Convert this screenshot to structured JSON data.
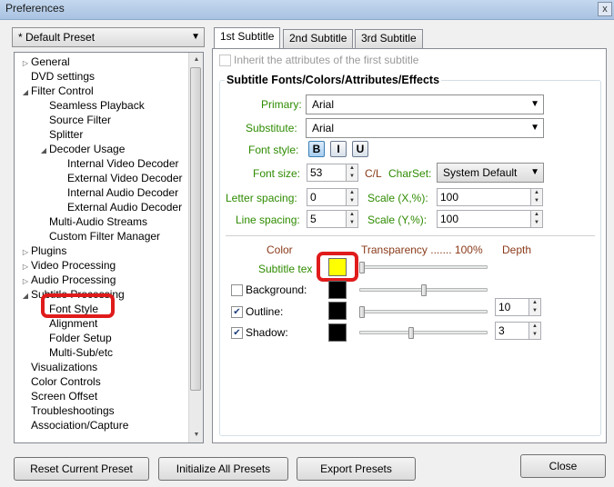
{
  "window": {
    "title": "Preferences",
    "close_glyph": "x"
  },
  "preset_combo": {
    "value": "* Default Preset"
  },
  "tree": [
    {
      "label": "General",
      "expander": "▷",
      "level": 0
    },
    {
      "label": "DVD settings",
      "expander": "",
      "level": 0
    },
    {
      "label": "Filter Control",
      "expander": "◢",
      "level": 0
    },
    {
      "label": "Seamless Playback",
      "expander": "",
      "level": 1
    },
    {
      "label": "Source Filter",
      "expander": "",
      "level": 1
    },
    {
      "label": "Splitter",
      "expander": "",
      "level": 1
    },
    {
      "label": "Decoder Usage",
      "expander": "◢",
      "level": 1
    },
    {
      "label": "Internal Video Decoder",
      "expander": "",
      "level": 2
    },
    {
      "label": "External Video Decoder",
      "expander": "",
      "level": 2
    },
    {
      "label": "Internal Audio Decoder",
      "expander": "",
      "level": 2
    },
    {
      "label": "External Audio Decoder",
      "expander": "",
      "level": 2
    },
    {
      "label": "Multi-Audio Streams",
      "expander": "",
      "level": 1
    },
    {
      "label": "Custom Filter Manager",
      "expander": "",
      "level": 1
    },
    {
      "label": "Plugins",
      "expander": "▷",
      "level": 0
    },
    {
      "label": "Video Processing",
      "expander": "▷",
      "level": 0
    },
    {
      "label": "Audio Processing",
      "expander": "▷",
      "level": 0
    },
    {
      "label": "Subtitle Processing",
      "expander": "◢",
      "level": 0
    },
    {
      "label": "Font Style",
      "expander": "",
      "level": 1
    },
    {
      "label": "Alignment",
      "expander": "",
      "level": 1
    },
    {
      "label": "Folder Setup",
      "expander": "",
      "level": 1
    },
    {
      "label": "Multi-Sub/etc",
      "expander": "",
      "level": 1
    },
    {
      "label": "Visualizations",
      "expander": "",
      "level": 0
    },
    {
      "label": "Color Controls",
      "expander": "",
      "level": 0
    },
    {
      "label": "Screen Offset",
      "expander": "",
      "level": 0
    },
    {
      "label": "Troubleshootings",
      "expander": "",
      "level": 0
    },
    {
      "label": "Association/Capture",
      "expander": "",
      "level": 0
    }
  ],
  "tabs": [
    "1st Subtitle",
    "2nd Subtitle",
    "3rd Subtitle"
  ],
  "inherit_label": "Inherit the attributes of the first subtitle",
  "group_title": "Subtitle Fonts/Colors/Attributes/Effects",
  "fonts": {
    "primary_label": "Primary:",
    "primary_value": "Arial",
    "substitute_label": "Substitute:",
    "substitute_value": "Arial",
    "font_style_label": "Font style:",
    "bold": "B",
    "italic": "I",
    "underline": "U",
    "font_size_label": "Font size:",
    "font_size_value": "53",
    "cl_label": "C/L",
    "charset_label": "CharSet:",
    "charset_value": "System Default",
    "letter_spacing_label": "Letter spacing:",
    "letter_spacing_value": "0",
    "scale_x_label": "Scale (X,%):",
    "scale_x_value": "100",
    "line_spacing_label": "Line spacing:",
    "line_spacing_value": "5",
    "scale_y_label": "Scale (Y,%):",
    "scale_y_value": "100"
  },
  "effects": {
    "color_header": "Color",
    "transparency_header": "Transparency ....... 100%",
    "depth_header": "Depth",
    "subtitle_text_label": "Subtitle tex",
    "subtitle_text_color": "#ffff00",
    "background_label": "Background:",
    "background_checked": false,
    "background_color": "#000000",
    "outline_label": "Outline:",
    "outline_checked": true,
    "outline_color": "#000000",
    "outline_depth": "10",
    "shadow_label": "Shadow:",
    "shadow_checked": true,
    "shadow_color": "#000000",
    "shadow_depth": "3",
    "subtitle_transparency_pct": 0,
    "background_transparency_pct": 50,
    "outline_transparency_pct": 0,
    "shadow_transparency_pct": 40
  },
  "buttons": {
    "reset": "Reset Current Preset",
    "initialize": "Initialize All Presets",
    "export": "Export Presets",
    "close": "Close"
  },
  "colors": {
    "label_green": "#2e8b00",
    "label_brown": "#8a3a1a",
    "highlight_red": "#e01b1b"
  }
}
